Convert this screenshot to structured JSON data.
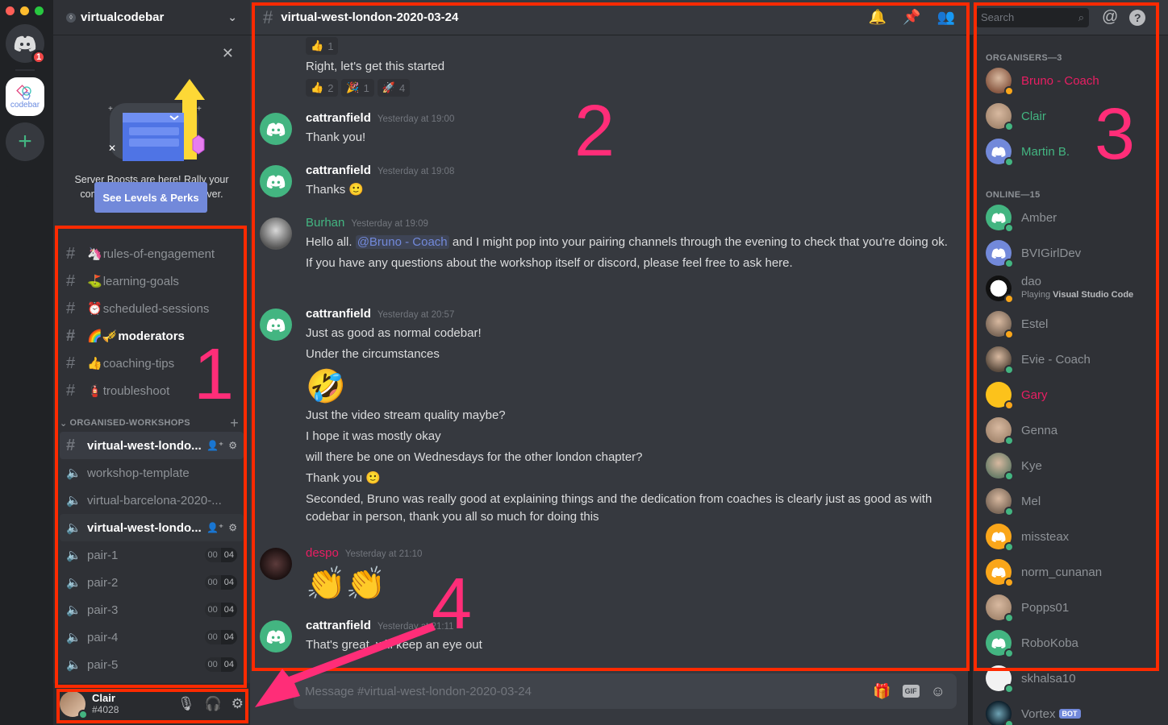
{
  "server": {
    "name": "virtualcodebar",
    "notification_count": "1",
    "codebar_label": "codebar"
  },
  "boost_card": {
    "text": "Server Boosts are here! Rally your community to boost your server.",
    "button_label": "See Levels & Perks"
  },
  "channels": [
    {
      "emoji": "🦄",
      "name": "rules-of-engagement"
    },
    {
      "emoji": "⛳",
      "name": "learning-goals"
    },
    {
      "emoji": "⏰",
      "name": "scheduled-sessions"
    },
    {
      "emoji": "🌈🎺",
      "name": "moderators"
    },
    {
      "emoji": "👍",
      "name": "coaching-tips"
    },
    {
      "emoji": "🧯",
      "name": "troubleshoot"
    }
  ],
  "category": {
    "name": "ORGANISED-WORKSHOPS"
  },
  "workshop_channels": [
    {
      "name": "virtual-west-londo..."
    },
    {
      "name": "workshop-template"
    },
    {
      "name": "virtual-barcelona-2020-..."
    },
    {
      "name": "virtual-west-londo..."
    }
  ],
  "pair_channels": [
    {
      "name": "pair-1",
      "users": "00",
      "limit": "04"
    },
    {
      "name": "pair-2",
      "users": "00",
      "limit": "04"
    },
    {
      "name": "pair-3",
      "users": "00",
      "limit": "04"
    },
    {
      "name": "pair-4",
      "users": "00",
      "limit": "04"
    },
    {
      "name": "pair-5",
      "users": "00",
      "limit": "04"
    }
  ],
  "user": {
    "name": "Clair",
    "tag": "#4028"
  },
  "chat": {
    "channel_title": "virtual-west-london-2020-03-24",
    "composer_placeholder": "Message #virtual-west-london-2020-03-24",
    "top_reaction": {
      "emoji": "👍",
      "count": "1"
    },
    "first_line": "Right, let's get this started",
    "first_reactions": [
      {
        "emoji": "👍",
        "count": "2"
      },
      {
        "emoji": "🎉",
        "count": "1"
      },
      {
        "emoji": "🚀",
        "count": "4"
      }
    ],
    "messages": [
      {
        "author": "cattranfield",
        "time": "Yesterday at 19:00",
        "lines": [
          "Thank you!"
        ]
      },
      {
        "author": "cattranfield",
        "time": "Yesterday at 19:08",
        "lines": [
          "Thanks 🙂"
        ]
      },
      {
        "author": "Burhan",
        "time": "Yesterday at 19:09",
        "pre_mention": "Hello all. ",
        "mention": "@Bruno - Coach",
        "post_mention": " and I might pop into your pairing channels through the evening to check that you're doing ok.",
        "line2": "If you have any questions about the workshop itself or discord, please feel free to ask here."
      },
      {
        "author": "cattranfield",
        "time": "Yesterday at 20:57",
        "lines": [
          "Just as good as normal codebar!",
          "Under the circumstances"
        ],
        "big_emoji": "🤣",
        "more_lines": [
          "Just the video stream quality maybe?",
          "I hope it was mostly okay",
          "will there be one on Wednesdays for the other london chapter?",
          "Thank you 🙂",
          "Seconded, Bruno was really good at explaining things and the dedication from coaches is clearly just as good as with codebar in person, thank you all so much for doing this"
        ]
      },
      {
        "author": "despo",
        "time": "Yesterday at 21:10",
        "big_emoji": "👏👏"
      },
      {
        "author": "cattranfield",
        "time": "Yesterday at 21:11",
        "lines": [
          "That's great, will keep an eye out"
        ]
      }
    ]
  },
  "search": {
    "placeholder": "Search"
  },
  "members": {
    "organisers_header": "ORGANISERS—3",
    "organisers": [
      {
        "name": "Bruno - Coach",
        "status": "idle",
        "color": "#e91e63"
      },
      {
        "name": "Clair",
        "status": "online",
        "color": "#43b581"
      },
      {
        "name": "Martin B.",
        "status": "online",
        "color": "#43b581"
      }
    ],
    "online_header": "ONLINE—15",
    "online": [
      {
        "name": "Amber",
        "status": "online"
      },
      {
        "name": "BVIGirlDev",
        "status": "online"
      },
      {
        "name": "dao",
        "status": "idle",
        "activity_prefix": "Playing ",
        "activity": "Visual Studio Code"
      },
      {
        "name": "Estel",
        "status": "idle"
      },
      {
        "name": "Evie - Coach",
        "status": "online"
      },
      {
        "name": "Gary",
        "status": "idle",
        "color": "#e91e63"
      },
      {
        "name": "Genna",
        "status": "online"
      },
      {
        "name": "Kye",
        "status": "online"
      },
      {
        "name": "Mel",
        "status": "online"
      },
      {
        "name": "missteax",
        "status": "online"
      },
      {
        "name": "norm_cunanan",
        "status": "idle"
      },
      {
        "name": "Popps01",
        "status": "online"
      },
      {
        "name": "RoboKoba",
        "status": "online"
      },
      {
        "name": "skhalsa10",
        "status": "online"
      },
      {
        "name": "Vortex",
        "status": "online",
        "badge": "BOT"
      }
    ]
  },
  "annotations": [
    "1",
    "2",
    "3",
    "4"
  ],
  "colors": {
    "annotation_box": "#ff2a00",
    "annotation_number": "#ff2d78",
    "accent": "#7289da",
    "online": "#43b581",
    "idle": "#faa61a"
  }
}
